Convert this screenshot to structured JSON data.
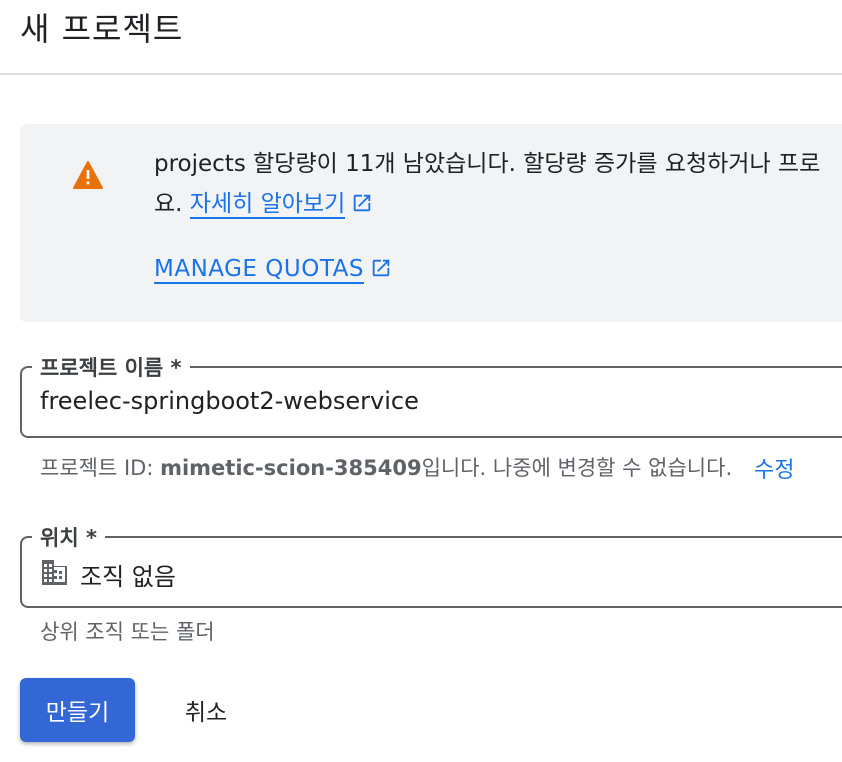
{
  "header": {
    "title": "새 프로젝트"
  },
  "quota": {
    "message_line1": "projects 할당량이 11개 남았습니다. 할당량 증가를 요청하거나 프로",
    "message_line2_prefix": "요. ",
    "learn_more": "자세히 알아보기",
    "manage_quotas": "MANAGE QUOTAS",
    "warning_color": "#e8710a"
  },
  "project_name": {
    "label": "프로젝트 이름 *",
    "value": "freelec-springboot2-webservice"
  },
  "project_id_hint": {
    "prefix": "프로젝트 ID: ",
    "id": "mimetic-scion-385409",
    "suffix": "입니다. 나중에 변경할 수 없습니다.",
    "edit_label": "수정"
  },
  "location": {
    "label": "위치 *",
    "value": "조직 없음",
    "icon": "building-icon",
    "hint": "상위 조직 또는 폴더"
  },
  "actions": {
    "create_label": "만들기",
    "cancel_label": "취소"
  },
  "colors": {
    "accent": "#1a73e8",
    "primary_button": "#3367d6",
    "panel_bg": "#f1f3f4"
  }
}
